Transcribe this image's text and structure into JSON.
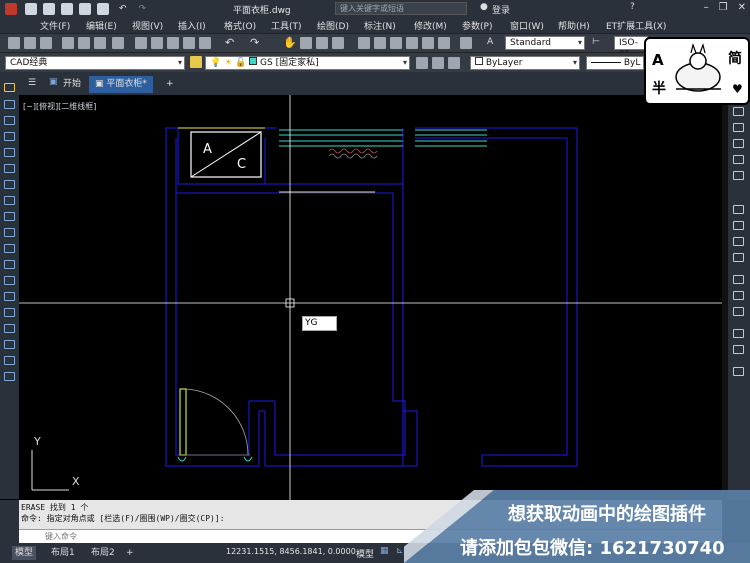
{
  "window": {
    "title": "平面衣柜.dwg",
    "search_placeholder": "键入关键字或短语",
    "login_label": "登录",
    "controls": [
      "–",
      "❐",
      "✕"
    ]
  },
  "menu": {
    "items": [
      "文件(F)",
      "编辑(E)",
      "视图(V)",
      "插入(I)",
      "格式(O)",
      "工具(T)",
      "绘图(D)",
      "标注(N)",
      "修改(M)",
      "参数(P)",
      "窗口(W)",
      "帮助(H)",
      "ET扩展工具(X)"
    ]
  },
  "toolbar": {
    "text_style": "Standard",
    "dim_style": "ISO-25"
  },
  "toolbar2": {
    "workspace": "CAD经典",
    "layer": "GS [固定家私]",
    "color": "ByLayer",
    "linetype": "ByL"
  },
  "tabs": {
    "start": "开始",
    "file": "平面衣柜*",
    "add": "+"
  },
  "viewport": {
    "label": "[−][俯视][二维线框]",
    "cursor_input": "YG",
    "block_text_a": "A",
    "block_text_c": "C",
    "ucs_x": "X",
    "ucs_y": "Y"
  },
  "command": {
    "history": [
      "ERASE 找到 1 个",
      "命令: 指定对角点或 [栏选(F)/圈围(WP)/圈交(CP)]:"
    ],
    "placeholder": "键入命令"
  },
  "status": {
    "layout_tabs": [
      "模型",
      "布局1",
      "布局2"
    ],
    "add": "+",
    "coordinates": "12231.1515, 8456.1841, 0.0000",
    "mode": "模型"
  },
  "logo": {
    "chars": [
      "A",
      "简",
      "半"
    ]
  },
  "promo": {
    "line1": "想获取动画中的绘图插件",
    "line2": "请添加包包微信: 1621730740"
  },
  "colors": {
    "wall": "#1a1ae6",
    "cabinet": "#f0e640",
    "hanger": "#3fd6c4",
    "crosshair": "#ffffff"
  }
}
